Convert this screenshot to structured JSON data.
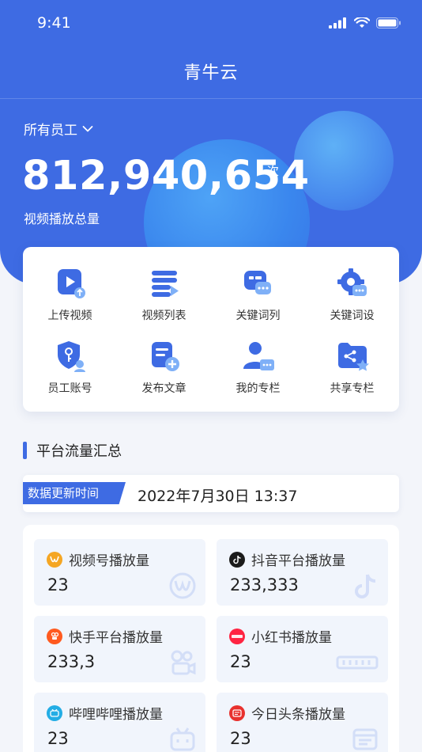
{
  "status": {
    "time": "9:41"
  },
  "nav": {
    "title": "青牛云"
  },
  "summary": {
    "employee_filter": "所有员工",
    "total_plays": "812,940,654",
    "unit": "次",
    "label": "视频播放总量"
  },
  "menu": [
    {
      "label": "上传视频",
      "icon": "upload-video-icon"
    },
    {
      "label": "视频列表",
      "icon": "video-list-icon"
    },
    {
      "label": "关键词列",
      "icon": "keyword-list-icon"
    },
    {
      "label": "关键词设",
      "icon": "keyword-settings-icon"
    },
    {
      "label": "员工账号",
      "icon": "employee-account-icon"
    },
    {
      "label": "发布文章",
      "icon": "publish-article-icon"
    },
    {
      "label": "我的专栏",
      "icon": "my-column-icon"
    },
    {
      "label": "共享专栏",
      "icon": "shared-column-icon"
    }
  ],
  "section": {
    "title": "平台流量汇总"
  },
  "update": {
    "tag": "数据更新时间",
    "time": "2022年7月30日 13:37"
  },
  "platforms": [
    {
      "name": "视频号播放量",
      "value": "23",
      "icon": "wechat-channels-icon",
      "color": "#f5a623"
    },
    {
      "name": "抖音平台播放量",
      "value": "233,333",
      "icon": "douyin-icon",
      "color": "#1b1b1b"
    },
    {
      "name": "快手平台播放量",
      "value": "233,3",
      "icon": "kuaishou-icon",
      "color": "#ff5a1f"
    },
    {
      "name": "小红书播放量",
      "value": "23",
      "icon": "xiaohongshu-icon",
      "color": "#ff2442"
    },
    {
      "name": "哔哩哔哩播放量",
      "value": "23",
      "icon": "bilibili-icon",
      "color": "#23ade5"
    },
    {
      "name": "今日头条播放量",
      "value": "23",
      "icon": "toutiao-icon",
      "color": "#e8312e"
    }
  ],
  "colors": {
    "accent": "#3e6be3",
    "background": "#f3f5fa"
  }
}
